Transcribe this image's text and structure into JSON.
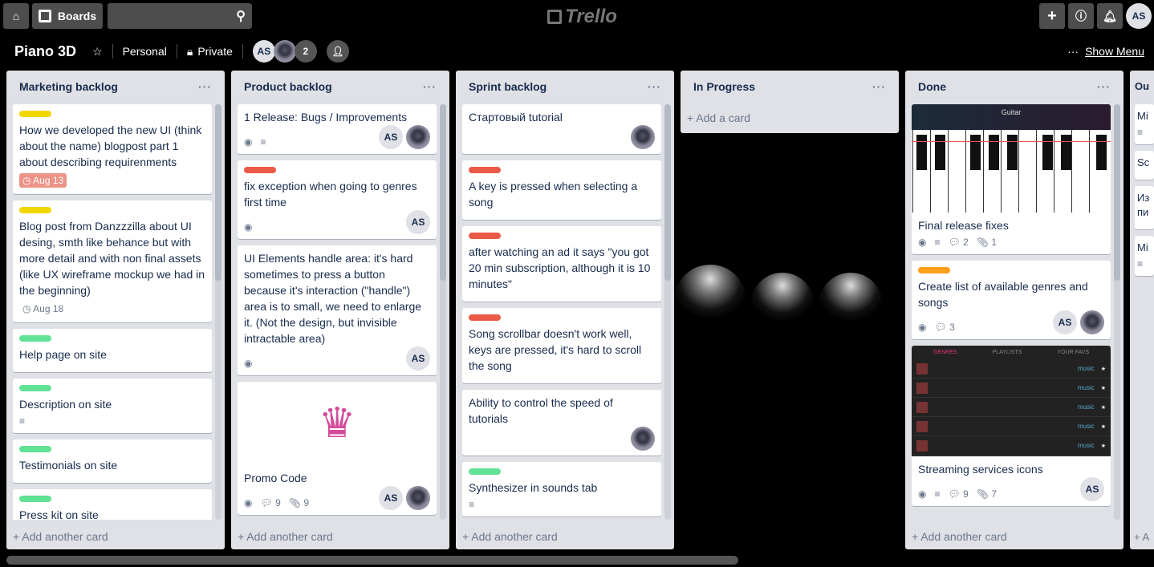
{
  "header": {
    "boards_label": "Boards",
    "search_placeholder": "",
    "logo": "Trello",
    "user_initials": "AS"
  },
  "board": {
    "title": "Piano 3D",
    "team": "Personal",
    "visibility": "Private",
    "members": [
      "AS"
    ],
    "extra_members": "2",
    "show_menu": "Show Menu"
  },
  "colors": {
    "yellow": "#f2d600",
    "green": "#61e294",
    "red": "#eb5a46",
    "orange": "#ff9f1a",
    "list_bg": "#dfe1e6"
  },
  "lists": [
    {
      "title": "Marketing backlog",
      "add": "+ Add another card",
      "cards": [
        {
          "label": "yellow",
          "title": "How we developed the new UI (think about the name) blogpost part 1 about describing requirenments",
          "due": "Aug 13",
          "due_red": true
        },
        {
          "label": "yellow",
          "title": "Blog post from Danzzzilla about UI desing, smth like behance but with more detail and with non final assets (like UX wireframe mockup we had in the beginning)",
          "due": "Aug 18"
        },
        {
          "label": "green",
          "title": "Help page on site"
        },
        {
          "label": "green",
          "title": "Description on site",
          "desc": true
        },
        {
          "label": "green",
          "title": "Testimonials on site"
        },
        {
          "label": "green",
          "title": "Press kit on site",
          "desc": true
        }
      ]
    },
    {
      "title": "Product backlog",
      "add": "+ Add another card",
      "cards": [
        {
          "title": "1 Release: Bugs / Improvements",
          "watch": true,
          "desc": true,
          "members": [
            "AS",
            "photo"
          ]
        },
        {
          "label": "red",
          "title": "fix exception when going to genres first time",
          "watch": true,
          "members": [
            "AS"
          ]
        },
        {
          "title": "UI Elements handle area: it's hard sometimes to press a button because it's interaction (\"handle\") area is to small, we need to enlarge it. (Not the design, but invisible intractable area)",
          "watch": true,
          "members": [
            "AS"
          ]
        },
        {
          "cover": "crown",
          "title": "Promo Code",
          "watch": true,
          "comments": "9",
          "attachments": "9",
          "members": [
            "AS",
            "photo"
          ]
        },
        {
          "cover": "dark",
          "title": ""
        }
      ]
    },
    {
      "title": "Sprint backlog",
      "add": "+ Add another card",
      "cards": [
        {
          "title": "Стартовый tutorial",
          "members": [
            "photo"
          ]
        },
        {
          "label": "red",
          "title": "A key is pressed when selecting a song"
        },
        {
          "label": "red",
          "title": "after watching an ad it says \"you got 20 min subscription, although it is 10 minutes\""
        },
        {
          "label": "red",
          "title": "Song scrollbar doesn't work well, keys are pressed, it's hard to scroll the song"
        },
        {
          "title": "Ability to control the speed of tutorials",
          "members": [
            "photo"
          ]
        },
        {
          "label": "green",
          "title": "Synthesizer in sounds tab",
          "desc": true
        },
        {
          "label": "red",
          "title": ""
        }
      ]
    },
    {
      "title": "In Progress",
      "add": "+ Add a card",
      "cards": []
    },
    {
      "title": "Done",
      "add": "+ Add another card",
      "cards": [
        {
          "cover": "piano",
          "cover_text": "Guitar",
          "title": "Final release fixes",
          "watch": true,
          "desc": true,
          "comments": "2",
          "attachments": "1"
        },
        {
          "label": "orange",
          "title": "Create list of available genres and songs",
          "watch": true,
          "comments": "3",
          "members": [
            "AS",
            "photo"
          ]
        },
        {
          "cover": "stream",
          "cover_tabs": [
            "GENRES",
            "PLAYLISTS",
            "YOUR FAVS"
          ],
          "title": "Streaming services icons",
          "watch": true,
          "desc": true,
          "comments": "9",
          "attachments": "7",
          "members": [
            "AS"
          ]
        }
      ]
    },
    {
      "title": "Ou",
      "add": "+ A",
      "cards": [
        {
          "title": "Mi",
          "desc": true
        },
        {
          "title": "Sc"
        },
        {
          "title": "Из пи"
        },
        {
          "title": "Mi",
          "desc": true
        }
      ]
    }
  ]
}
